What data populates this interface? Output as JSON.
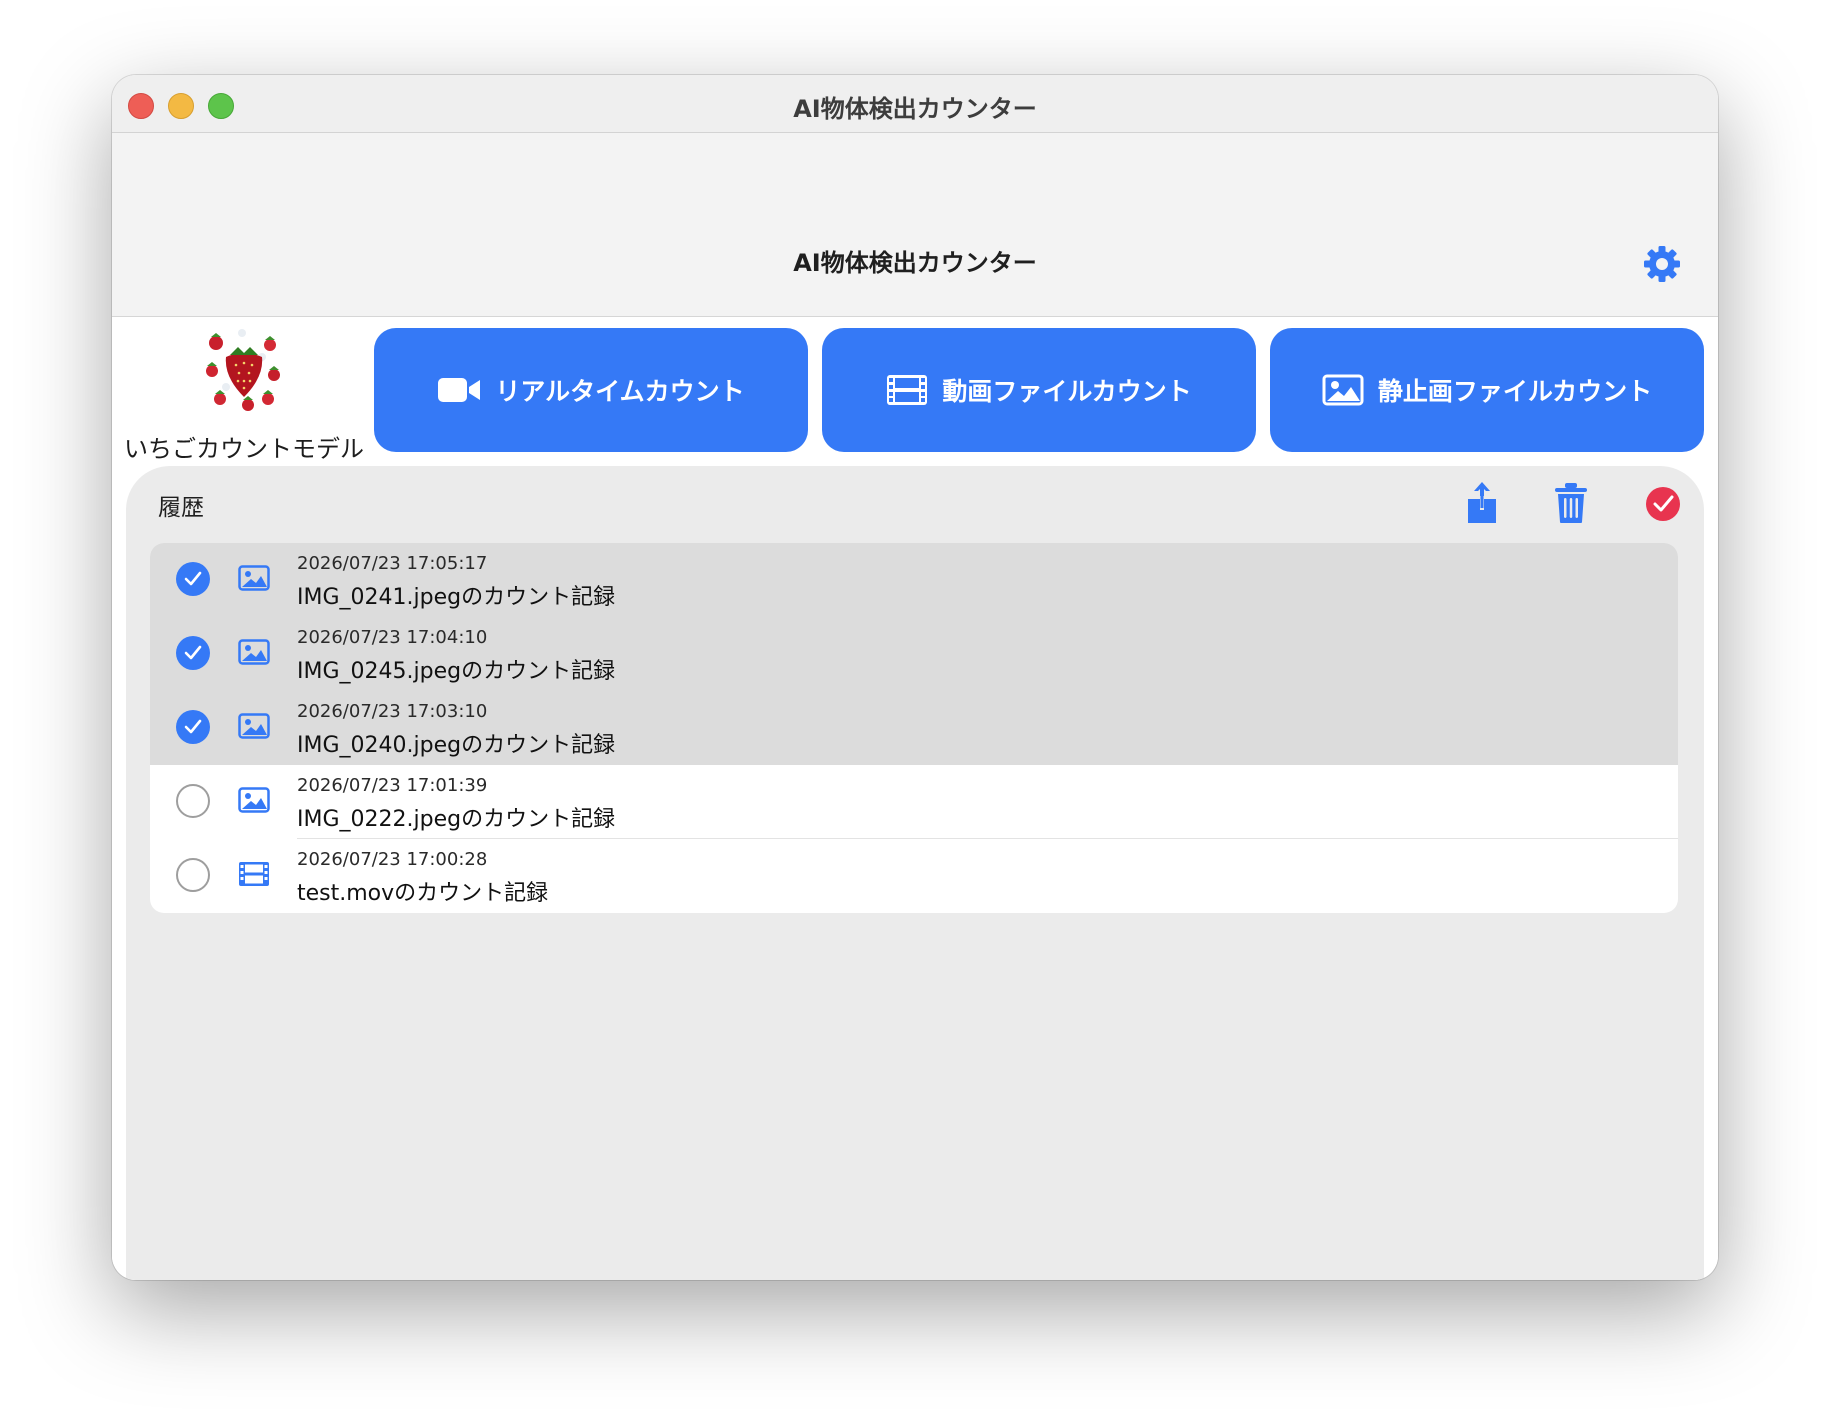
{
  "window": {
    "title": "AI物体検出カウンター"
  },
  "navbar": {
    "title": "AI物体検出カウンター",
    "settings_icon": "gear-icon"
  },
  "logo": {
    "label": "いちごカウントモデル"
  },
  "modes": [
    {
      "label": "リアルタイムカウント",
      "icon": "video-camera-icon"
    },
    {
      "label": "動画ファイルカウント",
      "icon": "film-icon"
    },
    {
      "label": "静止画ファイルカウント",
      "icon": "photo-icon"
    }
  ],
  "history": {
    "title": "履歴",
    "toolbar": {
      "share_icon": "share-icon",
      "trash_icon": "trash-icon",
      "select_icon": "checkmark-circle-icon"
    },
    "items": [
      {
        "timestamp": "2026/07/23 17:05:17",
        "name": "IMG_0241.jpegのカウント記録",
        "kind": "photo",
        "selected": true
      },
      {
        "timestamp": "2026/07/23 17:04:10",
        "name": "IMG_0245.jpegのカウント記録",
        "kind": "photo",
        "selected": true
      },
      {
        "timestamp": "2026/07/23 17:03:10",
        "name": "IMG_0240.jpegのカウント記録",
        "kind": "photo",
        "selected": true
      },
      {
        "timestamp": "2026/07/23 17:01:39",
        "name": "IMG_0222.jpegのカウント記録",
        "kind": "photo",
        "selected": false
      },
      {
        "timestamp": "2026/07/23 17:00:28",
        "name": "test.movのカウント記録",
        "kind": "film",
        "selected": false
      }
    ]
  },
  "colors": {
    "accent": "#3579f6",
    "danger": "#e8344f",
    "panel": "#ebebeb",
    "selected_row": "#dcdcdc"
  }
}
